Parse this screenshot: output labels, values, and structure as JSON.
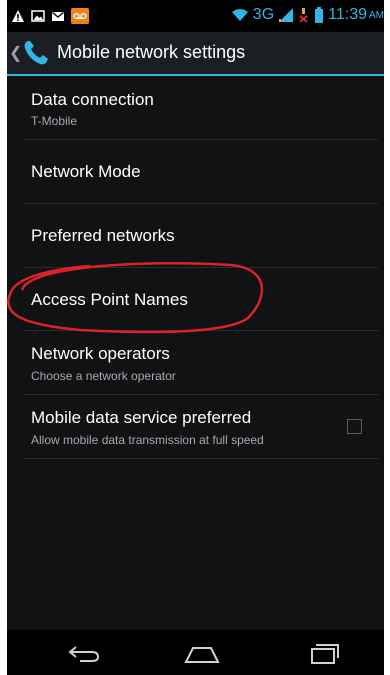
{
  "statusbar": {
    "network_type": "3G",
    "time": "11:39",
    "ampm": "AM",
    "left_icons": [
      "warning-icon",
      "picture-icon",
      "gmail-icon",
      "voicemail-icon"
    ],
    "right_icons": [
      "wifi-icon",
      "signal-icon",
      "no-sim-icon",
      "battery-icon"
    ]
  },
  "actionbar": {
    "title": "Mobile network settings",
    "back_icon": "back-caret-icon",
    "app_icon": "phone-icon"
  },
  "settings": [
    {
      "title": "Data connection",
      "subtitle": "T-Mobile"
    },
    {
      "title": "Network Mode",
      "subtitle": ""
    },
    {
      "title": "Preferred networks",
      "subtitle": ""
    },
    {
      "title": "Access Point Names",
      "subtitle": ""
    },
    {
      "title": "Network operators",
      "subtitle": "Choose a network operator"
    },
    {
      "title": "Mobile data service preferred",
      "subtitle": "Allow mobile data transmission at full speed",
      "checked": false
    }
  ],
  "navbar": {
    "back_icon": "back-icon",
    "home_icon": "home-icon",
    "recents_icon": "recent-apps-icon"
  },
  "colors": {
    "accent": "#33b5e5",
    "annotation": "#d8232a",
    "background": "#101214"
  }
}
